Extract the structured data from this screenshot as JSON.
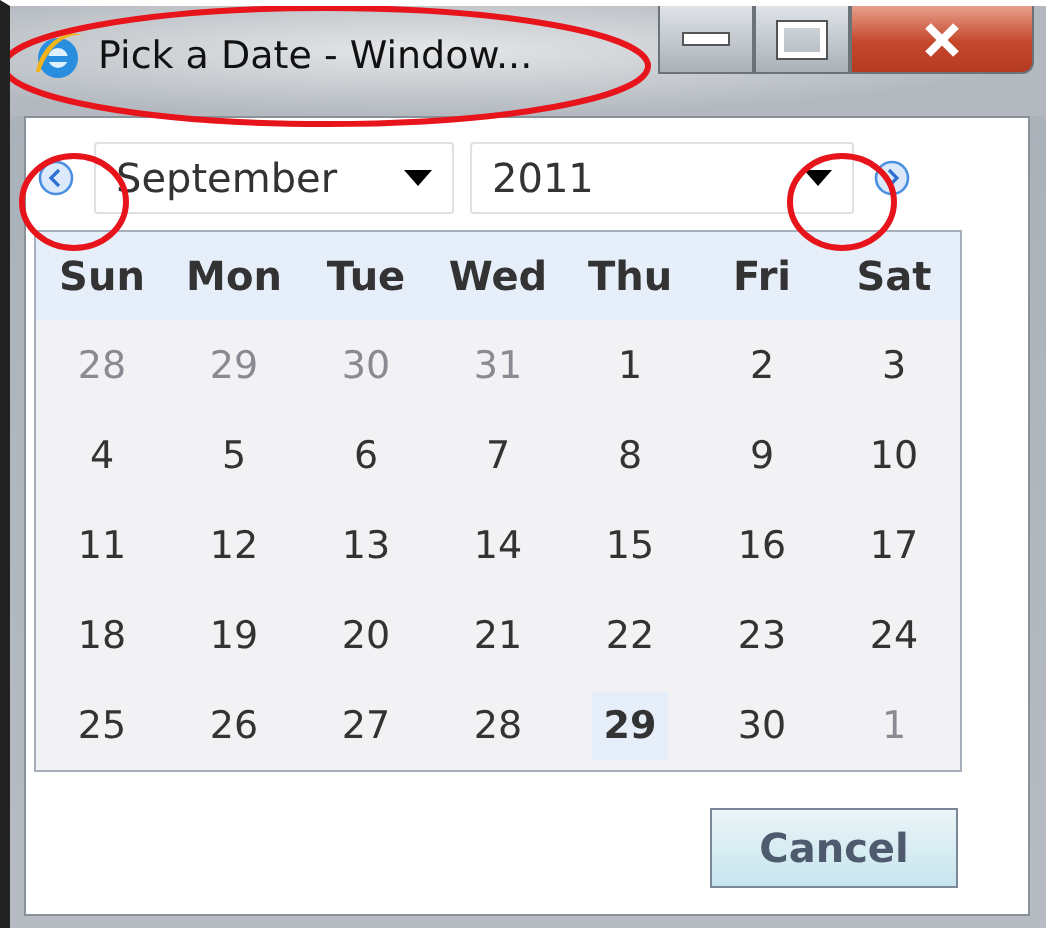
{
  "window": {
    "title": "Pick a Date - Window..."
  },
  "month": {
    "value": "September"
  },
  "year": {
    "value": "2011"
  },
  "weekdays": [
    "Sun",
    "Mon",
    "Tue",
    "Wed",
    "Thu",
    "Fri",
    "Sat"
  ],
  "weeks": [
    [
      {
        "day": "28",
        "muted": true,
        "selected": false
      },
      {
        "day": "29",
        "muted": true,
        "selected": false
      },
      {
        "day": "30",
        "muted": true,
        "selected": false
      },
      {
        "day": "31",
        "muted": true,
        "selected": false
      },
      {
        "day": "1",
        "muted": false,
        "selected": false
      },
      {
        "day": "2",
        "muted": false,
        "selected": false
      },
      {
        "day": "3",
        "muted": false,
        "selected": false
      }
    ],
    [
      {
        "day": "4",
        "muted": false,
        "selected": false
      },
      {
        "day": "5",
        "muted": false,
        "selected": false
      },
      {
        "day": "6",
        "muted": false,
        "selected": false
      },
      {
        "day": "7",
        "muted": false,
        "selected": false
      },
      {
        "day": "8",
        "muted": false,
        "selected": false
      },
      {
        "day": "9",
        "muted": false,
        "selected": false
      },
      {
        "day": "10",
        "muted": false,
        "selected": false
      }
    ],
    [
      {
        "day": "11",
        "muted": false,
        "selected": false
      },
      {
        "day": "12",
        "muted": false,
        "selected": false
      },
      {
        "day": "13",
        "muted": false,
        "selected": false
      },
      {
        "day": "14",
        "muted": false,
        "selected": false
      },
      {
        "day": "15",
        "muted": false,
        "selected": false
      },
      {
        "day": "16",
        "muted": false,
        "selected": false
      },
      {
        "day": "17",
        "muted": false,
        "selected": false
      }
    ],
    [
      {
        "day": "18",
        "muted": false,
        "selected": false
      },
      {
        "day": "19",
        "muted": false,
        "selected": false
      },
      {
        "day": "20",
        "muted": false,
        "selected": false
      },
      {
        "day": "21",
        "muted": false,
        "selected": false
      },
      {
        "day": "22",
        "muted": false,
        "selected": false
      },
      {
        "day": "23",
        "muted": false,
        "selected": false
      },
      {
        "day": "24",
        "muted": false,
        "selected": false
      }
    ],
    [
      {
        "day": "25",
        "muted": false,
        "selected": false
      },
      {
        "day": "26",
        "muted": false,
        "selected": false
      },
      {
        "day": "27",
        "muted": false,
        "selected": false
      },
      {
        "day": "28",
        "muted": false,
        "selected": false
      },
      {
        "day": "29",
        "muted": false,
        "selected": true
      },
      {
        "day": "30",
        "muted": false,
        "selected": false
      },
      {
        "day": "1",
        "muted": true,
        "selected": false
      }
    ]
  ],
  "buttons": [
    "Cancel"
  ]
}
